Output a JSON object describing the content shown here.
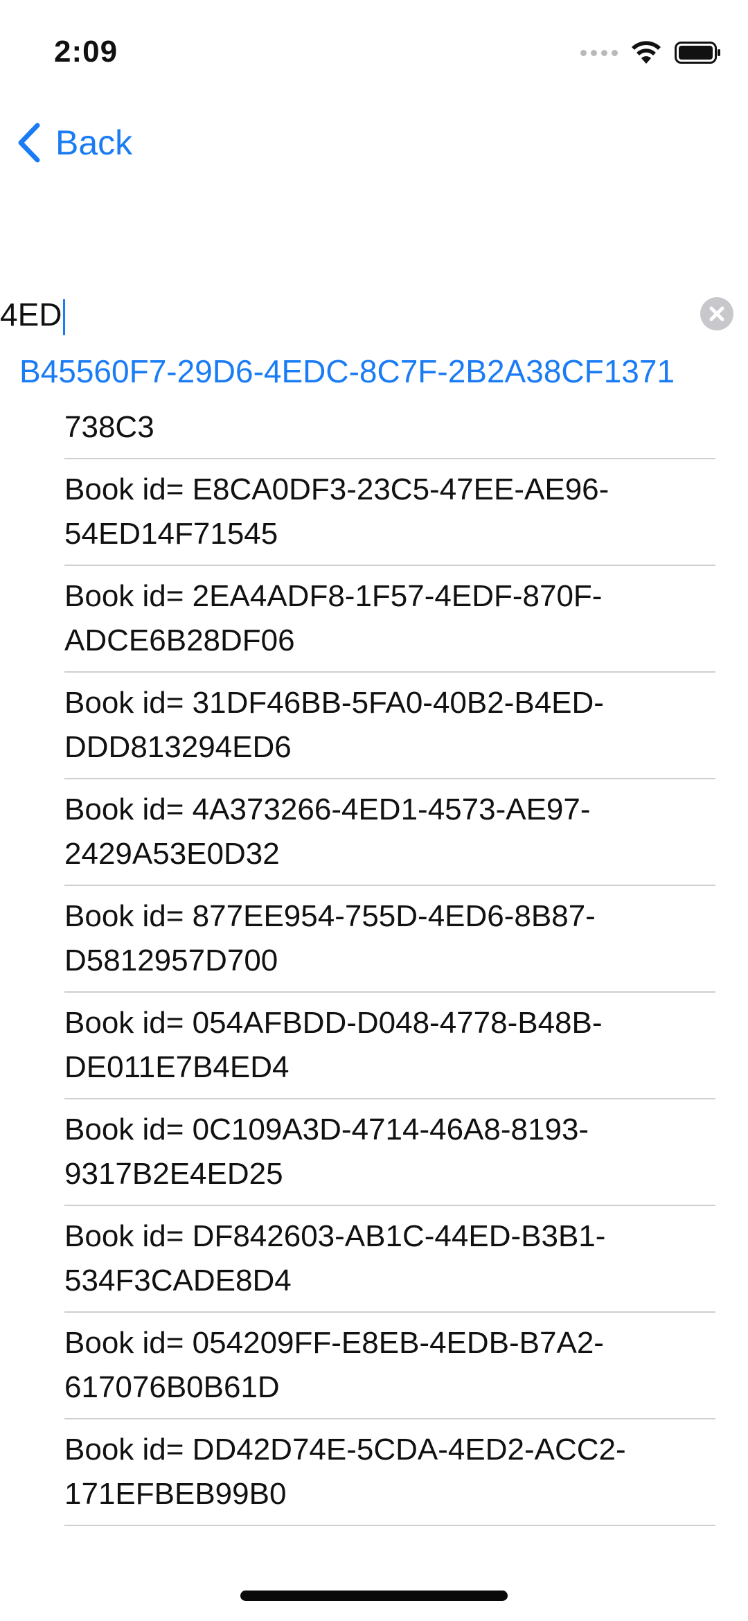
{
  "status_bar": {
    "time": "2:09",
    "icons": [
      "signal-icon",
      "wifi-icon",
      "battery-icon"
    ]
  },
  "nav": {
    "back_label": "Back"
  },
  "search": {
    "value": "4ED",
    "clear_icon": "clear-circle-icon"
  },
  "selected_result": "B45560F7-29D6-4EDC-8C7F-2B2A38CF1371",
  "results": [
    "738C3",
    "Book id= E8CA0DF3-23C5-47EE-AE96-54ED14F71545",
    "Book id= 2EA4ADF8-1F57-4EDF-870F-ADCE6B28DF06",
    "Book id= 31DF46BB-5FA0-40B2-B4ED-DDD813294ED6",
    "Book id= 4A373266-4ED1-4573-AE97-2429A53E0D32",
    "Book id= 877EE954-755D-4ED6-8B87-D5812957D700",
    "Book id= 054AFBDD-D048-4778-B48B-DE011E7B4ED4",
    "Book id= 0C109A3D-4714-46A8-8193-9317B2E4ED25",
    "Book id= DF842603-AB1C-44ED-B3B1-534F3CADE8D4",
    "Book id= 054209FF-E8EB-4EDB-B7A2-617076B0B61D",
    "Book id= DD42D74E-5CDA-4ED2-ACC2-171EFBEB99B0"
  ],
  "colors": {
    "accent": "#1a7cf5",
    "text": "#111111",
    "separator": "#cfcfcf"
  }
}
